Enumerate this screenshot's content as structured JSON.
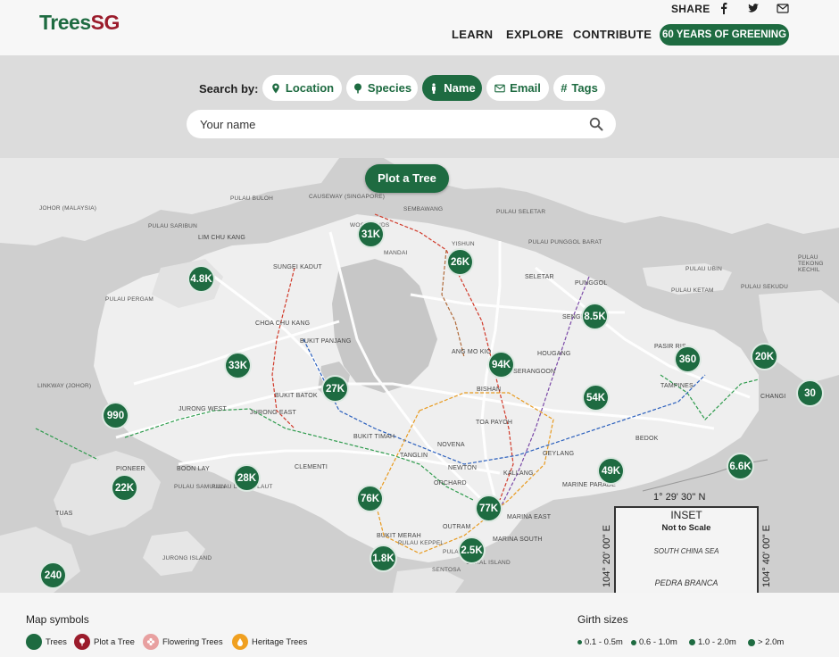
{
  "header": {
    "logo_part1": "Trees",
    "logo_part2": "SG",
    "share_label": "SHARE",
    "nav": [
      "LEARN",
      "EXPLORE",
      "CONTRIBUTE"
    ],
    "pill": "60 YEARS OF GREENING"
  },
  "search": {
    "label": "Search by:",
    "chips": [
      {
        "label": "Location",
        "icon": "map-pin-icon"
      },
      {
        "label": "Species",
        "icon": "tree-icon"
      },
      {
        "label": "Name",
        "icon": "person-icon"
      },
      {
        "label": "Email",
        "icon": "envelope-icon"
      },
      {
        "label": "Tags",
        "icon": "hash-icon"
      }
    ],
    "active": "Name",
    "placeholder": "Your name"
  },
  "map": {
    "plot_button": "Plot a Tree",
    "clusters": [
      {
        "label": "31K"
      },
      {
        "label": "26K"
      },
      {
        "label": "4.8K"
      },
      {
        "label": "8.5K"
      },
      {
        "label": "33K"
      },
      {
        "label": "94K"
      },
      {
        "label": "360"
      },
      {
        "label": "20K"
      },
      {
        "label": "27K"
      },
      {
        "label": "54K"
      },
      {
        "label": "30"
      },
      {
        "label": "990"
      },
      {
        "label": "28K"
      },
      {
        "label": "49K"
      },
      {
        "label": "6.6K"
      },
      {
        "label": "22K"
      },
      {
        "label": "76K"
      },
      {
        "label": "77K"
      },
      {
        "label": "1.8K"
      },
      {
        "label": "2.5K"
      },
      {
        "label": "240"
      }
    ],
    "places": [
      "CAUSEWAY (SINGAPORE)",
      "SEMBAWANG",
      "WOODLANDS",
      "MANDAI",
      "YISHUN",
      "PULAU SELETAR",
      "PULAU BULOH",
      "PULAU SARIBUN",
      "LIM CHU KANG",
      "SUNGEI KADUT",
      "JOHOR (MALAYSIA)",
      "PULAU PERGAM",
      "CHOA CHU KANG",
      "BUKIT PANJANG",
      "BUKIT BATOK",
      "JURONG WEST",
      "JURONG EAST",
      "LINKWAY (JOHOR)",
      "PIONEER",
      "BOON LAY",
      "PULAU SAMULUN",
      "PULAU DAMAR LAUT",
      "TUAS",
      "CLEMENTI",
      "BUKIT TIMAH",
      "NOVENA",
      "TOA PAYOH",
      "BISHAN",
      "ANG MO KIO",
      "SERANGOON",
      "HOUGANG",
      "SENGKANG",
      "PUNGGOL",
      "SELETAR",
      "PULAU PUNGGOL BARAT",
      "PULAU UBIN",
      "PULAU KETAM",
      "PULAU SEKUDU",
      "PULAU TEKONG KECHIL",
      "PASIR RIS",
      "TAMPINES",
      "CHANGI",
      "BEDOK",
      "GEYLANG",
      "KALLANG",
      "MARINE PARADE",
      "NEWTON",
      "ORCHARD",
      "TANGLIN",
      "OUTRAM",
      "BUKIT MERAH",
      "MARINA EAST",
      "MARINA SOUTH",
      "PULAU KEPPEL",
      "PULAU BRANI",
      "SENTOSA",
      "CORAL ISLAND",
      "JURONG ISLAND"
    ],
    "inset": {
      "title": "INSET",
      "subtitle": "Not to Scale",
      "sea": "SOUTH CHINA SEA",
      "island": "PEDRA BRANCA",
      "lat": "1° 29' 30'' N",
      "lon_left": "104° 20' 00'' E",
      "lon_right": "104° 40' 00'' E"
    }
  },
  "legend": {
    "symbols_title": "Map symbols",
    "symbols": [
      {
        "label": "Trees",
        "color": "#1e6b41"
      },
      {
        "label": "Plot a Tree",
        "color": "#9b1c2c"
      },
      {
        "label": "Flowering Trees",
        "color": "#e8a0a0"
      },
      {
        "label": "Heritage Trees",
        "color": "#f0a020"
      }
    ],
    "girth_title": "Girth sizes",
    "girth": [
      "0.1 - 0.5m",
      "0.6 - 1.0m",
      "1.0 - 2.0m",
      "> 2.0m"
    ]
  },
  "colors": {
    "brand_green": "#1e6b41",
    "brand_red": "#9b1c2c",
    "map_land": "#efefef",
    "map_sea": "#cfcfcf"
  }
}
